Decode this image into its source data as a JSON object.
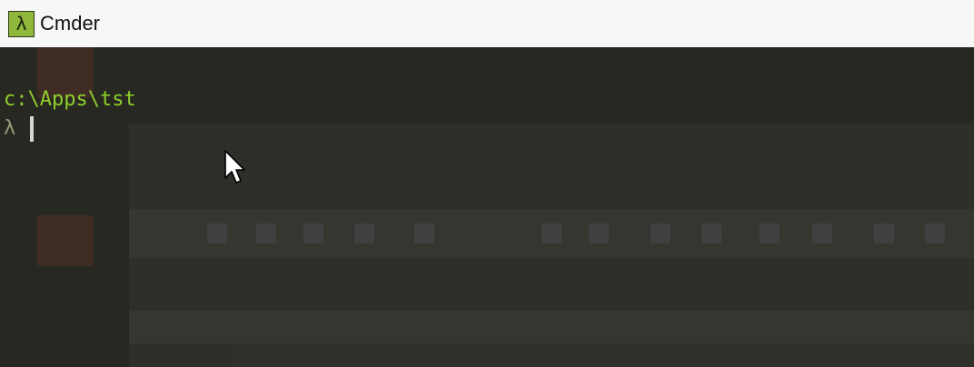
{
  "window": {
    "title": "Cmder",
    "icon": "lambda-icon",
    "icon_glyph": "λ",
    "accent_color": "#8fb83a"
  },
  "terminal": {
    "background": "#272822",
    "path": "c:\\Apps\\tst",
    "prompt_symbol": "λ",
    "path_color": "#8fce2a"
  }
}
